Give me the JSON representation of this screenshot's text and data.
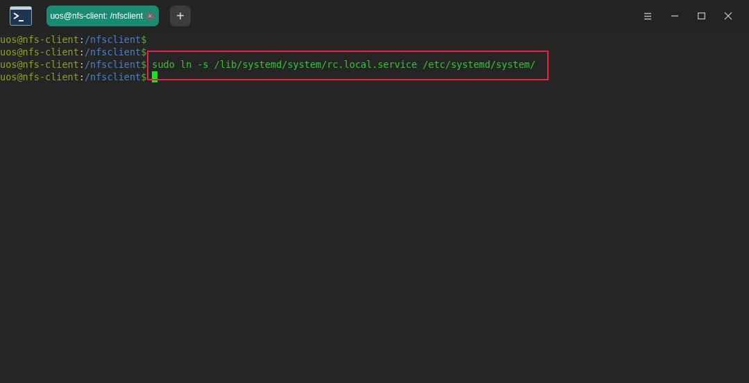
{
  "tabs": [
    {
      "title": "uos@nfs-client: /nfsclient",
      "selected": true,
      "close": "×"
    }
  ],
  "new_tab": "+",
  "lines": [
    {
      "user": "uos@nfs-client",
      "sep": ":",
      "path": "/nfsclient",
      "prompt": "$",
      "cursor": false
    },
    {
      "user": "uos@nfs-client",
      "sep": ":",
      "path": "/nfsclient",
      "prompt": "$",
      "cursor": false
    },
    {
      "user": "uos@nfs-client",
      "sep": ":",
      "path": "/nfsclient",
      "prompt": "$",
      "command": "sudo ln -s /lib/systemd/system/rc.local.service /etc/systemd/system/",
      "cursor": false
    },
    {
      "user": "uos@nfs-client",
      "sep": ":",
      "path": "/nfsclient",
      "prompt": "$",
      "cursor": true
    }
  ],
  "highlight": {
    "color": "#e8234a"
  }
}
